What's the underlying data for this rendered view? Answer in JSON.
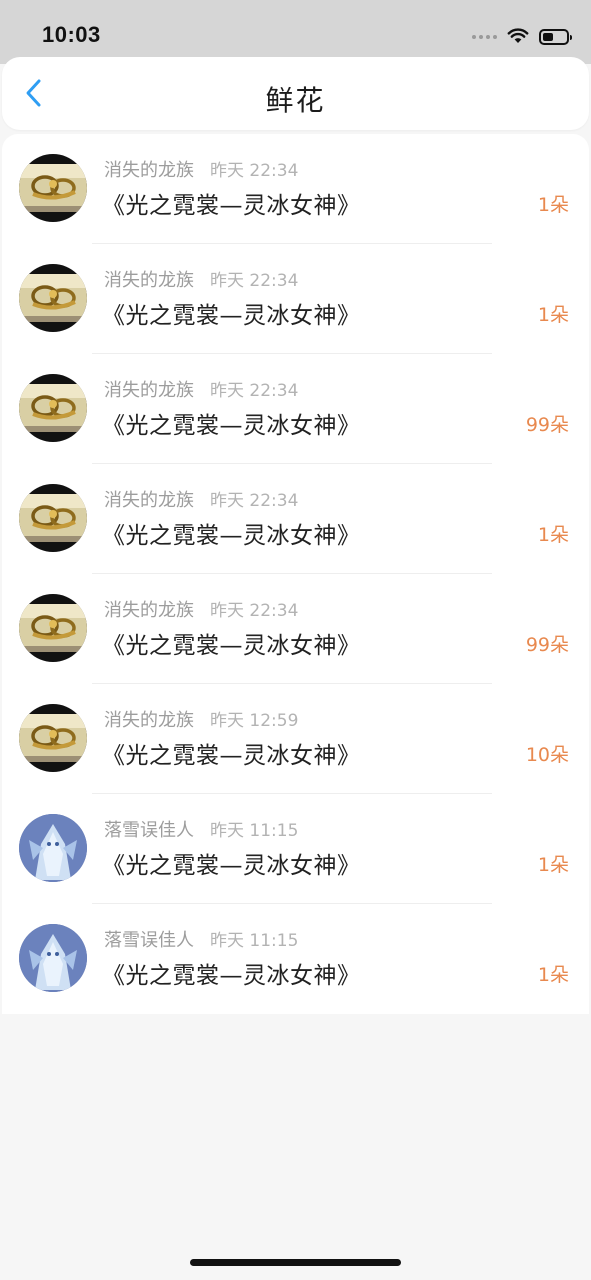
{
  "status_bar": {
    "time": "10:03",
    "battery_level": 0.45,
    "icons": [
      "signal-dots-icon",
      "wifi-icon",
      "battery-icon"
    ]
  },
  "header": {
    "title": "鲜花",
    "back_icon": "chevron-left-icon",
    "accent_color": "#2f9ef3"
  },
  "count_color": "#e8894f",
  "gifts": [
    {
      "user": "消失的龙族",
      "time": "昨天 22:34",
      "gift": "《光之霓裳—灵冰女神》",
      "count": "1朵",
      "avatar": "gold-avatar"
    },
    {
      "user": "消失的龙族",
      "time": "昨天 22:34",
      "gift": "《光之霓裳—灵冰女神》",
      "count": "1朵",
      "avatar": "gold-avatar"
    },
    {
      "user": "消失的龙族",
      "time": "昨天 22:34",
      "gift": "《光之霓裳—灵冰女神》",
      "count": "99朵",
      "avatar": "gold-avatar"
    },
    {
      "user": "消失的龙族",
      "time": "昨天 22:34",
      "gift": "《光之霓裳—灵冰女神》",
      "count": "1朵",
      "avatar": "gold-avatar"
    },
    {
      "user": "消失的龙族",
      "time": "昨天 22:34",
      "gift": "《光之霓裳—灵冰女神》",
      "count": "99朵",
      "avatar": "gold-avatar"
    },
    {
      "user": "消失的龙族",
      "time": "昨天 12:59",
      "gift": "《光之霓裳—灵冰女神》",
      "count": "10朵",
      "avatar": "gold-avatar"
    },
    {
      "user": "落雪误佳人",
      "time": "昨天 11:15",
      "gift": "《光之霓裳—灵冰女神》",
      "count": "1朵",
      "avatar": "blue-avatar"
    },
    {
      "user": "落雪误佳人",
      "time": "昨天 11:15",
      "gift": "《光之霓裳—灵冰女神》",
      "count": "1朵",
      "avatar": "blue-avatar"
    }
  ]
}
